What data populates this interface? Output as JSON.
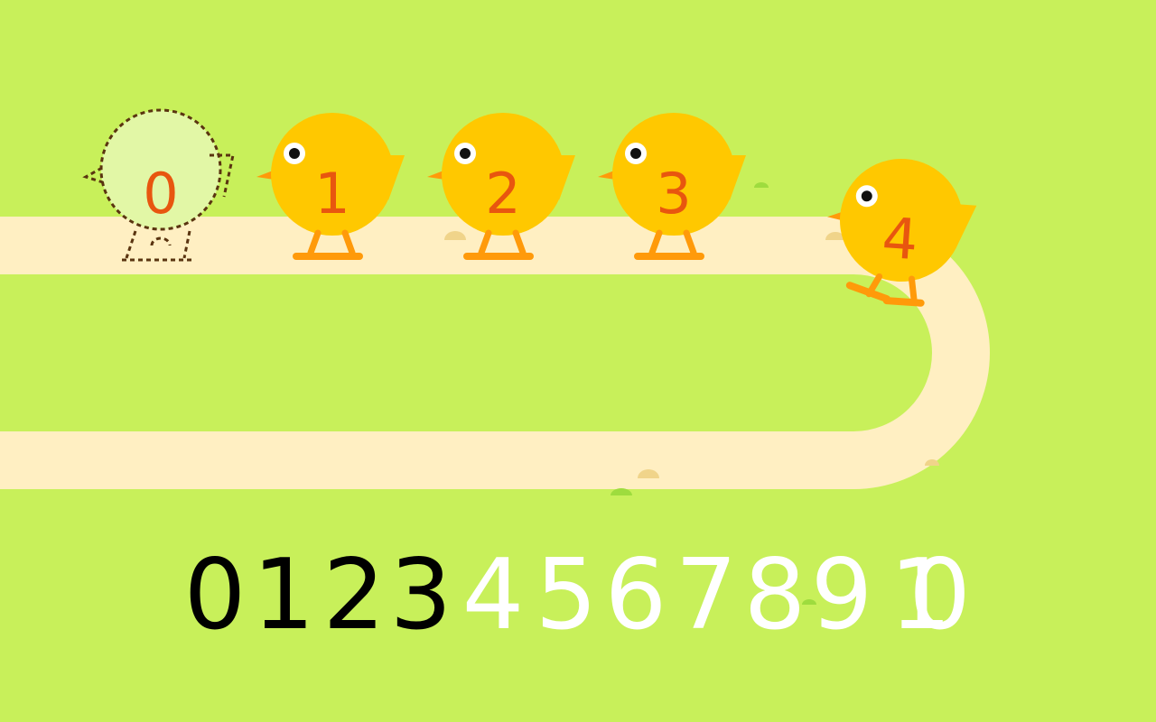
{
  "colors": {
    "background": "#c8f05a",
    "path": "#ffefc2",
    "chick_body": "#ffc800",
    "chick_feet": "#ff9a0a",
    "chick_number": "#e8560f",
    "placeholder_fill": "#e2f7a6",
    "placeholder_outline": "#5a3410",
    "counted_digit": "#000000",
    "remaining_digit": "#ffffff"
  },
  "chicks": [
    {
      "number": "0",
      "state": "empty-outline"
    },
    {
      "number": "1",
      "state": "filled"
    },
    {
      "number": "2",
      "state": "filled"
    },
    {
      "number": "3",
      "state": "filled"
    },
    {
      "number": "4",
      "state": "filled-walking"
    }
  ],
  "number_line": {
    "digits": [
      "0",
      "1",
      "2",
      "3",
      "4",
      "5",
      "6",
      "7",
      "8",
      "9",
      "10"
    ],
    "counted_up_to": 3
  }
}
